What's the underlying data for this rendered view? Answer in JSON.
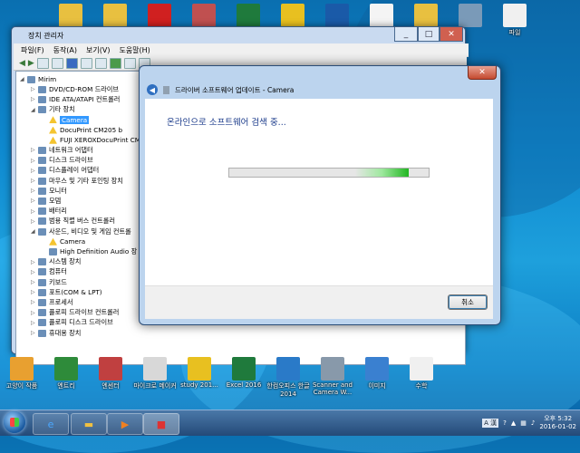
{
  "desktop_top_icons": [
    {
      "name": "folder-icon",
      "label": ""
    },
    {
      "name": "folder-icon",
      "label": ""
    },
    {
      "name": "no-entry-icon",
      "label": ""
    },
    {
      "name": "person-icon",
      "label": ""
    },
    {
      "name": "excel-icon",
      "label": ""
    },
    {
      "name": "pdf-icon",
      "label": ""
    },
    {
      "name": "outlook-icon",
      "label": ""
    },
    {
      "name": "file-icon",
      "label": ""
    },
    {
      "name": "folder-icon",
      "label": ""
    },
    {
      "name": "window-icon",
      "label": ""
    },
    {
      "name": "hangul-icon",
      "label": "파일"
    }
  ],
  "devmgr": {
    "title": "장치 관리자",
    "menu": [
      "파일(F)",
      "동작(A)",
      "보기(V)",
      "도움말(H)"
    ],
    "tree": [
      {
        "label": "Mirim",
        "level": 0,
        "icon": "computer"
      },
      {
        "label": "DVD/CD-ROM 드라이브",
        "level": 1
      },
      {
        "label": "IDE ATA/ATAPI 컨트롤러",
        "level": 1
      },
      {
        "label": "기타 장치",
        "level": 1,
        "expanded": true
      },
      {
        "label": "Camera",
        "level": 2,
        "warn": true,
        "selected": true
      },
      {
        "label": "DocuPrint CM205 b",
        "level": 2,
        "warn": true
      },
      {
        "label": "FUJI XEROXDocuPrint CM",
        "level": 2,
        "warn": true
      },
      {
        "label": "네트워크 어댑터",
        "level": 1
      },
      {
        "label": "디스크 드라이브",
        "level": 1
      },
      {
        "label": "디스플레이 어댑터",
        "level": 1
      },
      {
        "label": "마우스 및 기타 포인팅 장치",
        "level": 1
      },
      {
        "label": "모니터",
        "level": 1
      },
      {
        "label": "모뎀",
        "level": 1
      },
      {
        "label": "배터리",
        "level": 1
      },
      {
        "label": "범용 직렬 버스 컨트롤러",
        "level": 1
      },
      {
        "label": "사운드, 비디오 및 게임 컨트롤",
        "level": 1,
        "expanded": true
      },
      {
        "label": "Camera",
        "level": 2,
        "warn": true
      },
      {
        "label": "High Definition Audio 장",
        "level": 2
      },
      {
        "label": "시스템 장치",
        "level": 1
      },
      {
        "label": "컴퓨터",
        "level": 1
      },
      {
        "label": "키보드",
        "level": 1
      },
      {
        "label": "포트(COM & LPT)",
        "level": 1
      },
      {
        "label": "프로세서",
        "level": 1
      },
      {
        "label": "플로피 드라이브 컨트롤러",
        "level": 1
      },
      {
        "label": "플로피 디스크 드라이브",
        "level": 1
      },
      {
        "label": "휴대용 장치",
        "level": 1
      }
    ]
  },
  "dialog": {
    "title": "드라이버 소프트웨어 업데이트 - Camera",
    "heading": "온라인으로 소프트웨어 검색 중...",
    "cancel": "취소",
    "close": "✕",
    "progress": 0.9
  },
  "desktop_bottom_icons": [
    {
      "label": "고양이 작품",
      "color": "#e8a030"
    },
    {
      "label": "엔트리",
      "color": "#2e8b3a"
    },
    {
      "label": "엔센터",
      "color": "#c04040"
    },
    {
      "label": "마이크로 메이커",
      "color": "#d8d8d8"
    },
    {
      "label": "study 201...",
      "color": "#e8c020"
    },
    {
      "label": "Excel 2016",
      "color": "#1f7a3c"
    },
    {
      "label": "한컴오피스 한글 2014",
      "color": "#2a7ac8"
    },
    {
      "label": "Scanner and Camera W...",
      "color": "#8899aa"
    },
    {
      "label": "이미지",
      "color": "#3a80d0"
    },
    {
      "label": "수학",
      "color": "#f0f0f0"
    }
  ],
  "taskbar": {
    "time": "오후 5:32",
    "date": "2016-01-02",
    "lang": "A 漢"
  }
}
